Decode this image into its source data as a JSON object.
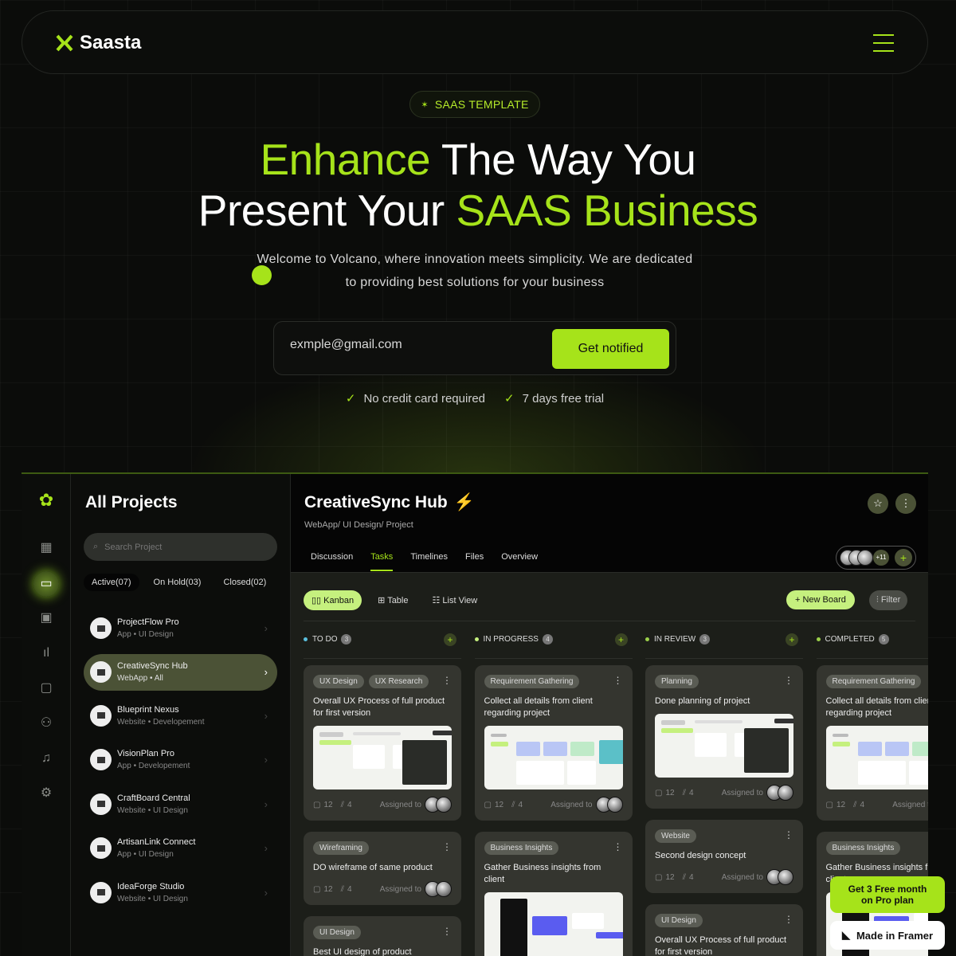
{
  "brand": {
    "name": "Saasta",
    "accent": "#a6e31a"
  },
  "hero": {
    "badge": "SAAS TEMPLATE",
    "line1a": "Enhance",
    "line1b": " The Way You",
    "line2a": "Present Your ",
    "line2b": "SAAS Business",
    "sub1": "Welcome to Volcano, where innovation meets simplicity. We are dedicated",
    "sub2": "to providing best solutions for your business",
    "email_value": "exmple@gmail.com",
    "cta": "Get notified",
    "check1": "No credit card required",
    "check2": "7 days free trial"
  },
  "panel": {
    "title": "All Projects",
    "search_placeholder": "Search Project",
    "filters": [
      "Active(07)",
      "On Hold(03)",
      "Closed(02)"
    ],
    "projects": [
      {
        "name": "ProjectFlow Pro",
        "type": "App",
        "cat": "UI Design"
      },
      {
        "name": "CreativeSync Hub",
        "type": "WebApp",
        "cat": "All",
        "selected": true
      },
      {
        "name": "Blueprint Nexus",
        "type": "Website",
        "cat": "Developement"
      },
      {
        "name": "VisionPlan Pro",
        "type": "App",
        "cat": "Developement"
      },
      {
        "name": "CraftBoard Central",
        "type": "Website",
        "cat": "UI Design"
      },
      {
        "name": "ArtisanLink Connect",
        "type": "App",
        "cat": "UI Design"
      },
      {
        "name": "IdeaForge Studio",
        "type": "Website",
        "cat": "UI Design"
      }
    ]
  },
  "main": {
    "title": "CreativeSync Hub",
    "breadcrumb": "WebApp/ UI Design/ Project",
    "tabs": [
      "Discussion",
      "Tasks",
      "Timelines",
      "Files",
      "Overview"
    ],
    "active_tab": "Tasks",
    "members_more": "+11",
    "views": [
      "Kanban",
      "Table",
      "List View"
    ],
    "new_board": "+ New Board",
    "filter": "Filter",
    "columns": [
      {
        "name": "TO DO",
        "count": "3",
        "color": "#5bc0de",
        "cards": [
          {
            "tags": [
              "UX Design",
              "UX Research"
            ],
            "title": "Overall UX Process of full product for first version",
            "thumb": "calendar",
            "comments": "12",
            "files": "4",
            "assigned": "Assigned to"
          },
          {
            "tags": [
              "Wireframing"
            ],
            "title": "DO wireframe of same product",
            "comments": "12",
            "files": "4",
            "assigned": "Assigned to"
          },
          {
            "tags": [
              "UI Design"
            ],
            "title": "Best UI design of product"
          }
        ]
      },
      {
        "name": "IN PROGRESS",
        "count": "4",
        "color": "#c5f07e",
        "cards": [
          {
            "tags": [
              "Requirement Gathering"
            ],
            "title": "Collect all details from client regarding project",
            "thumb": "dashboard",
            "comments": "12",
            "files": "4",
            "assigned": "Assigned to"
          },
          {
            "tags": [
              "Business Insights"
            ],
            "title": "Gather Business insights from client",
            "thumb": "dark"
          }
        ]
      },
      {
        "name": "IN REVIEW",
        "count": "3",
        "color": "#9bd04a",
        "cards": [
          {
            "tags": [
              "Planning"
            ],
            "title": "Done planning of project",
            "thumb": "calendar",
            "comments": "12",
            "files": "4",
            "assigned": "Assigned to"
          },
          {
            "tags": [
              "Website"
            ],
            "title": "Second design concept",
            "comments": "12",
            "files": "4",
            "assigned": "Assigned to"
          },
          {
            "tags": [
              "UI Design"
            ],
            "title": "Overall UX Process of full product for first version"
          }
        ]
      },
      {
        "name": "COMPLETED",
        "count": "5",
        "color": "#9bd04a",
        "cards": [
          {
            "tags": [
              "Requirement Gathering"
            ],
            "title": "Collect all details from client regarding project",
            "thumb": "dashboard",
            "comments": "12",
            "files": "4",
            "assigned": "Assigned to"
          },
          {
            "tags": [
              "Business Insights"
            ],
            "title": "Gather Business insights from client",
            "thumb": "dark"
          }
        ]
      }
    ]
  },
  "promo": {
    "line1": "Get 3 Free month",
    "line2": "on Pro plan",
    "framer": "Made in Framer"
  }
}
